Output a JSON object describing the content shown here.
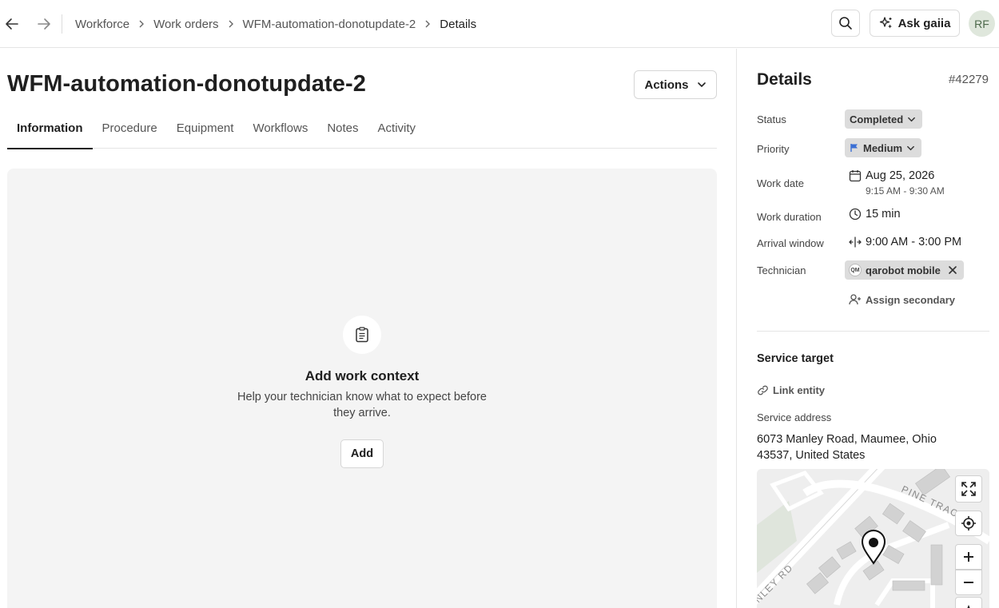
{
  "topbar": {
    "breadcrumb": [
      "Workforce",
      "Work orders",
      "WFM-automation-donotupdate-2",
      "Details"
    ],
    "ask_label": "Ask gaiia",
    "avatar_initials": "RF"
  },
  "main": {
    "title": "WFM-automation-donotupdate-2",
    "actions_label": "Actions",
    "tabs": [
      "Information",
      "Procedure",
      "Equipment",
      "Workflows",
      "Notes",
      "Activity"
    ],
    "active_tab": "Information",
    "context": {
      "title": "Add work context",
      "description": "Help your technician know what to expect before they arrive.",
      "add_label": "Add"
    }
  },
  "details": {
    "title": "Details",
    "id": "#42279",
    "status": {
      "label": "Status",
      "value": "Completed"
    },
    "priority": {
      "label": "Priority",
      "value": "Medium",
      "flag_color": "#3b6fd4"
    },
    "work_date": {
      "label": "Work date",
      "date": "Aug 25, 2026",
      "time": "9:15 AM - 9:30 AM"
    },
    "work_duration": {
      "label": "Work duration",
      "value": "15 min"
    },
    "arrival_window": {
      "label": "Arrival window",
      "value": "9:00 AM - 3:00 PM"
    },
    "technician": {
      "label": "Technician",
      "initials": "QM",
      "name": "qarobot mobile"
    },
    "assign_secondary": "Assign secondary",
    "service_target": {
      "title": "Service target",
      "link_entity": "Link entity",
      "address_label": "Service address",
      "address": "6073 Manley Road, Maumee, Ohio 43537, United States"
    },
    "map": {
      "street_labels": [
        "PINE TRACE DR",
        "NLEY RD"
      ]
    }
  }
}
